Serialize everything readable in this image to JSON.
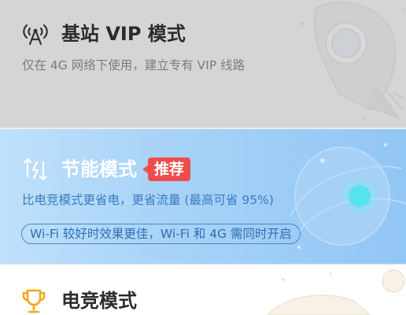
{
  "modes": [
    {
      "id": "vip",
      "icon": "broadcast-tower-icon",
      "title": "基站 VIP 模式",
      "description": "仅在 4G 网络下使用，建立专有 VIP 线路"
    },
    {
      "id": "eco",
      "icon": "energy-saving-icon",
      "title": "节能模式",
      "badge": "推荐",
      "description": "比电竞模式更省电，更省流量 (最高可省 95%)",
      "note": "Wi-Fi 较好时效果更佳，Wi-Fi 和 4G 需同时开启"
    },
    {
      "id": "esports",
      "icon": "trophy-icon",
      "title": "电竞模式"
    }
  ],
  "colors": {
    "vip_bg": "#d5d5d5",
    "eco_bg": "#a8d3f7",
    "eco_accent": "#3b7cc0",
    "badge": "#ef4d4d",
    "trophy": "#f0a81e"
  },
  "decorations": [
    "rocket-illustration",
    "planet-illustration",
    "spaceship-illustration"
  ]
}
